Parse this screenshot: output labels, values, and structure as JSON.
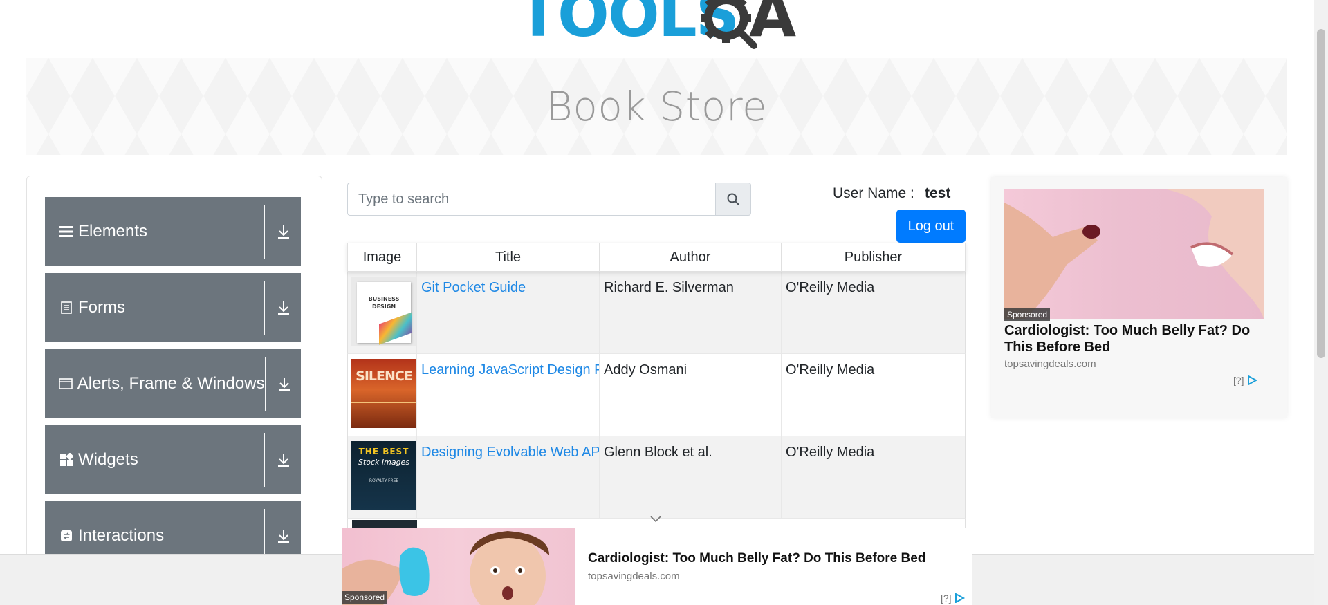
{
  "logo": {
    "text": "TOOLS",
    "suffix": "A"
  },
  "banner": {
    "title": "Book Store"
  },
  "sidebar": {
    "groups": [
      {
        "label": "Elements",
        "icon": "hamburger-icon"
      },
      {
        "label": "Forms",
        "icon": "document-icon"
      },
      {
        "label": "Alerts, Frame & Windows",
        "icon": "window-icon"
      },
      {
        "label": "Widgets",
        "icon": "widgets-icon"
      },
      {
        "label": "Interactions",
        "icon": "interactions-icon"
      }
    ]
  },
  "search": {
    "placeholder": "Type to search",
    "value": ""
  },
  "user": {
    "label": "User Name :",
    "value": "test",
    "logout_label": "Log out"
  },
  "table": {
    "headers": [
      "Image",
      "Title",
      "Author",
      "Publisher"
    ],
    "rows": [
      {
        "title": "Git Pocket Guide",
        "author": "Richard E. Silverman",
        "publisher": "O'Reilly Media"
      },
      {
        "title": "Learning JavaScript Design Pa",
        "author": "Addy Osmani",
        "publisher": "O'Reilly Media"
      },
      {
        "title": "Designing Evolvable Web API",
        "author": "Glenn Block et al.",
        "publisher": "O'Reilly Media"
      }
    ],
    "covers": [
      {
        "line1": "BUSINESS",
        "line2": "DESIGN"
      },
      {
        "line1": "SILENCE"
      },
      {
        "line1": "THE BEST",
        "line2": "Stock Images",
        "line3": "ROYALTY-FREE"
      }
    ]
  },
  "ad_right": {
    "sponsored": "Sponsored",
    "title": "Cardiologist: Too Much Belly Fat? Do This Before Bed",
    "domain": "topsavingdeals.com",
    "marks": "[?]"
  },
  "ad_bottom": {
    "sponsored": "Sponsored",
    "title": "Cardiologist: Too Much Belly Fat? Do This Before Bed",
    "domain": "topsavingdeals.com",
    "marks": "[?]"
  },
  "colors": {
    "nav_bg": "#6c757d",
    "primary": "#007bff",
    "link": "#1e88e5",
    "logo_blue": "#1a9fd9"
  }
}
